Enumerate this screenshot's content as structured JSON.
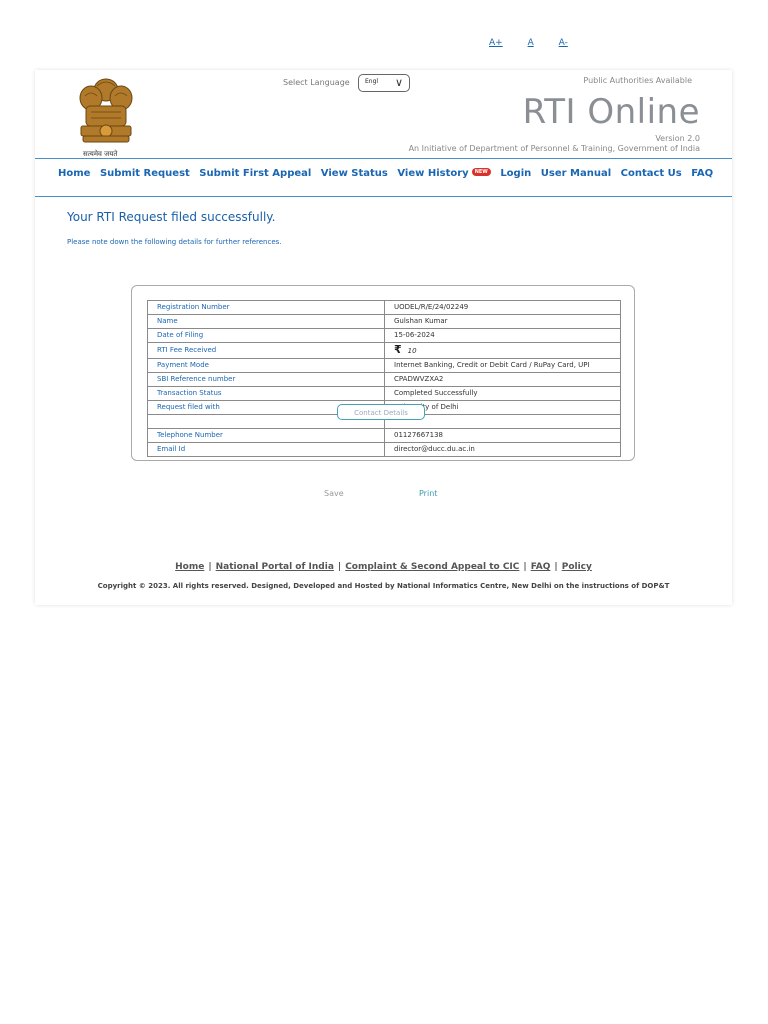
{
  "font_controls": {
    "increase": "A+",
    "normal": "A",
    "decrease": "A-"
  },
  "header": {
    "motto": "सत्यमेव जयते",
    "language_label": "Select Language",
    "language_value": "Engl",
    "public_authorities": "Public Authorities Available",
    "title": "RTI Online",
    "version": "Version 2.0",
    "initiative": "An Initiative of Department of Personnel & Training, Government of India"
  },
  "nav": {
    "items": [
      "Home",
      "Submit Request",
      "Submit First Appeal",
      "View Status",
      "View History",
      "Login",
      "User Manual",
      "Contact Us",
      "FAQ"
    ],
    "new_badge": "NEW"
  },
  "main": {
    "success_message": "Your RTI Request filed successfully.",
    "note": "Please note down the following details for further references.",
    "rows": [
      {
        "label": "Registration Number",
        "value": "UODEL/R/E/24/02249"
      },
      {
        "label": "Name",
        "value": "Gulshan Kumar"
      },
      {
        "label": "Date of Filing",
        "value": "15-06-2024"
      },
      {
        "label": "RTI Fee Received",
        "value": "10",
        "currency": "₹"
      },
      {
        "label": "Payment Mode",
        "value": "Internet Banking, Credit or Debit Card / RuPay Card, UPI"
      },
      {
        "label": "SBI Reference number",
        "value": "CPADWVZXA2"
      },
      {
        "label": "Transaction Status",
        "value": "Completed Successfully"
      },
      {
        "label": "Request filed with",
        "value": "University of Delhi"
      },
      {
        "label": "",
        "value": ""
      },
      {
        "label": "Telephone Number",
        "value": "01127667138"
      },
      {
        "label": "Email Id",
        "value": "director@ducc.du.ac.in"
      }
    ],
    "contact_details_button": "Contact Details",
    "save": "Save",
    "print": "Print"
  },
  "footer": {
    "links": [
      "Home",
      "National Portal of India",
      "Complaint & Second Appeal to CIC",
      "FAQ",
      "Policy"
    ],
    "copyright": "Copyright © 2023. All rights reserved. Designed, Developed and Hosted by National Informatics Centre, New Delhi on the instructions of DOP&T"
  },
  "colors": {
    "link": "#1a66b3",
    "rule": "#4a90c8",
    "title": "#8a8f96",
    "badge": "#d9322b"
  }
}
